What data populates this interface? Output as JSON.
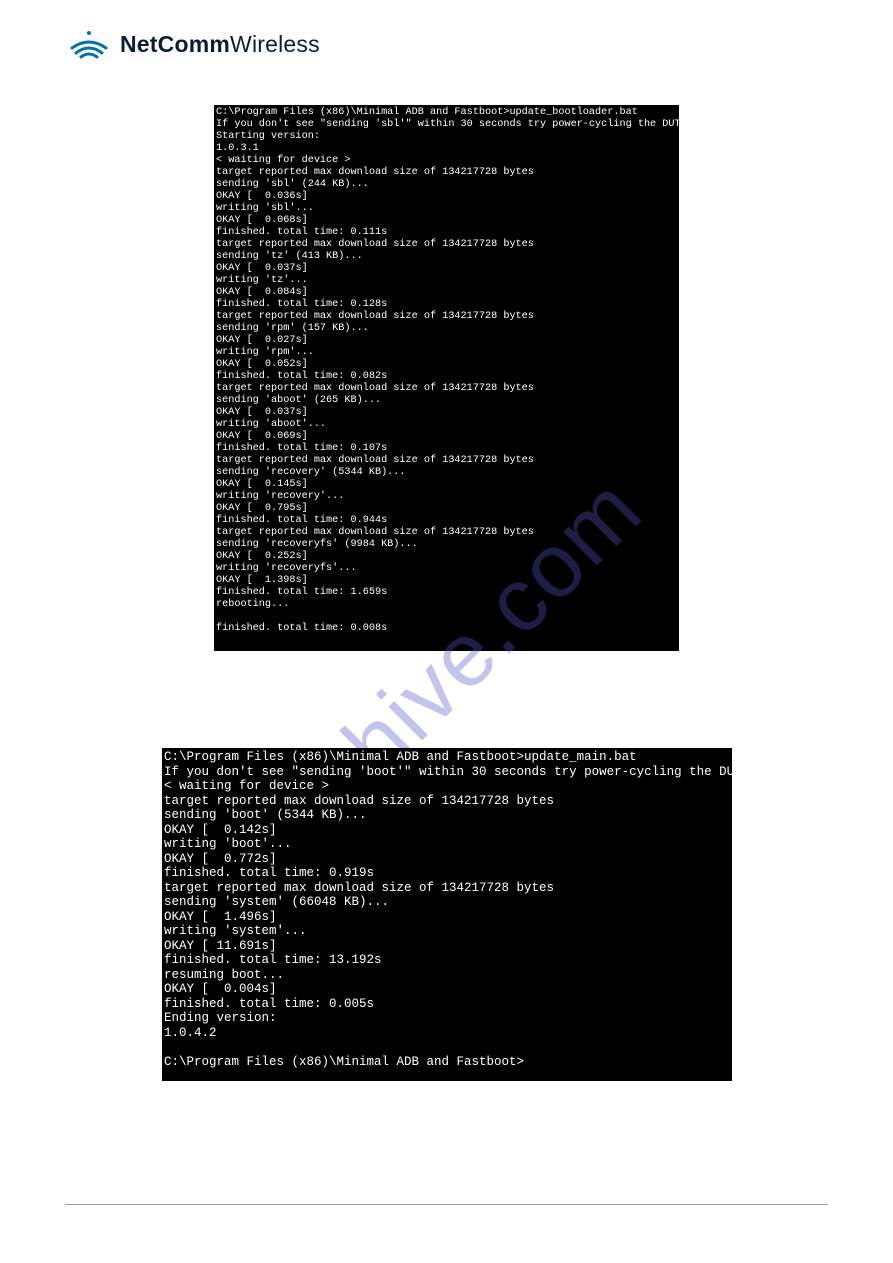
{
  "brand": {
    "name_bold": "NetComm",
    "name_light": "Wireless"
  },
  "watermark": "alshive.com",
  "terminal1": {
    "lines": [
      "C:\\Program Files (x86)\\Minimal ADB and Fastboot>update_bootloader.bat",
      "If you don't see \"sending 'sbl'\" within 30 seconds try power-cycling the DUT",
      "Starting version:",
      "1.0.3.1",
      "< waiting for device >",
      "target reported max download size of 134217728 bytes",
      "sending 'sbl' (244 KB)...",
      "OKAY [  0.036s]",
      "writing 'sbl'...",
      "OKAY [  0.068s]",
      "finished. total time: 0.111s",
      "target reported max download size of 134217728 bytes",
      "sending 'tz' (413 KB)...",
      "OKAY [  0.037s]",
      "writing 'tz'...",
      "OKAY [  0.084s]",
      "finished. total time: 0.128s",
      "target reported max download size of 134217728 bytes",
      "sending 'rpm' (157 KB)...",
      "OKAY [  0.027s]",
      "writing 'rpm'...",
      "OKAY [  0.052s]",
      "finished. total time: 0.082s",
      "target reported max download size of 134217728 bytes",
      "sending 'aboot' (265 KB)...",
      "OKAY [  0.037s]",
      "writing 'aboot'...",
      "OKAY [  0.069s]",
      "finished. total time: 0.107s",
      "target reported max download size of 134217728 bytes",
      "sending 'recovery' (5344 KB)...",
      "OKAY [  0.145s]",
      "writing 'recovery'...",
      "OKAY [  0.795s]",
      "finished. total time: 0.944s",
      "target reported max download size of 134217728 bytes",
      "sending 'recoveryfs' (9984 KB)...",
      "OKAY [  0.252s]",
      "writing 'recoveryfs'...",
      "OKAY [  1.398s]",
      "finished. total time: 1.659s",
      "rebooting...",
      "",
      "finished. total time: 0.008s"
    ]
  },
  "terminal2": {
    "lines": [
      "C:\\Program Files (x86)\\Minimal ADB and Fastboot>update_main.bat",
      "If you don't see \"sending 'boot'\" within 30 seconds try power-cycling the DUT",
      "< waiting for device >",
      "target reported max download size of 134217728 bytes",
      "sending 'boot' (5344 KB)...",
      "OKAY [  0.142s]",
      "writing 'boot'...",
      "OKAY [  0.772s]",
      "finished. total time: 0.919s",
      "target reported max download size of 134217728 bytes",
      "sending 'system' (66048 KB)...",
      "OKAY [  1.496s]",
      "writing 'system'...",
      "OKAY [ 11.691s]",
      "finished. total time: 13.192s",
      "resuming boot...",
      "OKAY [  0.004s]",
      "finished. total time: 0.005s",
      "Ending version:",
      "1.0.4.2",
      "",
      "C:\\Program Files (x86)\\Minimal ADB and Fastboot>"
    ]
  }
}
